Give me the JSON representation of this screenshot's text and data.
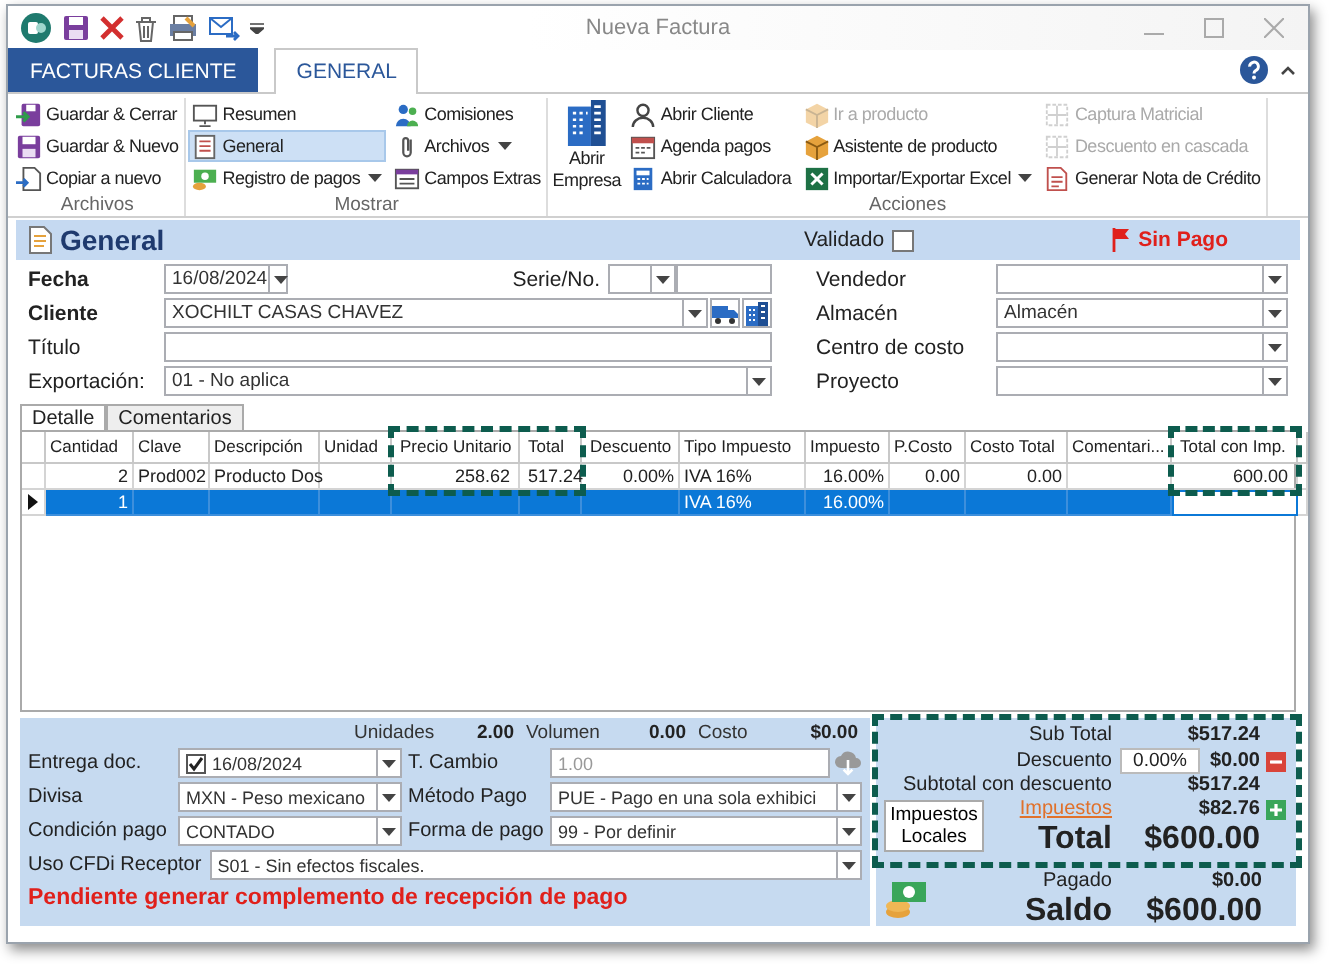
{
  "window": {
    "title": "Nueva Factura"
  },
  "ribbon": {
    "tabs": [
      {
        "label": "FACTURAS CLIENTE",
        "kind": "app",
        "selected": false
      },
      {
        "label": "GENERAL",
        "kind": "tab",
        "selected": true
      }
    ],
    "groups": [
      {
        "title": "Archivos",
        "columns": [
          [
            {
              "label": "Guardar & Cerrar",
              "kind": "small",
              "disabled": false,
              "selected": false,
              "dropdown": false
            },
            {
              "label": "Guardar & Nuevo",
              "kind": "small",
              "disabled": false,
              "selected": false,
              "dropdown": false
            },
            {
              "label": "Copiar a nuevo",
              "kind": "small",
              "disabled": false,
              "selected": false,
              "dropdown": false
            }
          ]
        ]
      },
      {
        "title": "Mostrar",
        "columns": [
          [
            {
              "label": "Resumen",
              "kind": "small",
              "disabled": false,
              "selected": false,
              "dropdown": false
            },
            {
              "label": "General",
              "kind": "small",
              "disabled": false,
              "selected": true,
              "dropdown": false
            },
            {
              "label": "Registro de pagos",
              "kind": "small",
              "disabled": false,
              "selected": false,
              "dropdown": true
            }
          ],
          [
            {
              "label": "Comisiones",
              "kind": "small",
              "disabled": false,
              "selected": false,
              "dropdown": false
            },
            {
              "label": "Archivos",
              "kind": "small",
              "disabled": false,
              "selected": false,
              "dropdown": true
            },
            {
              "label": "Campos Extras",
              "kind": "small",
              "disabled": false,
              "selected": false,
              "dropdown": false
            }
          ]
        ]
      },
      {
        "title": "Acciones",
        "columns": [
          [
            {
              "label": "Abrir Empresa",
              "kind": "large",
              "disabled": false,
              "selected": false,
              "dropdown": false
            }
          ],
          [
            {
              "label": "Abrir Cliente",
              "kind": "small",
              "disabled": false,
              "selected": false,
              "dropdown": false
            },
            {
              "label": "Agenda pagos",
              "kind": "small",
              "disabled": false,
              "selected": false,
              "dropdown": false
            },
            {
              "label": "Abrir Calculadora",
              "kind": "small",
              "disabled": false,
              "selected": false,
              "dropdown": false
            }
          ],
          [
            {
              "label": "Ir a producto",
              "kind": "small",
              "disabled": true,
              "selected": false,
              "dropdown": false
            },
            {
              "label": "Asistente de producto",
              "kind": "small",
              "disabled": false,
              "selected": false,
              "dropdown": false
            },
            {
              "label": "Importar/Exportar Excel",
              "kind": "small",
              "disabled": false,
              "selected": false,
              "dropdown": true
            }
          ],
          [
            {
              "label": "Captura Matricial",
              "kind": "small",
              "disabled": true,
              "selected": false,
              "dropdown": false
            },
            {
              "label": "Descuento en cascada",
              "kind": "small",
              "disabled": true,
              "selected": false,
              "dropdown": false
            },
            {
              "label": "Generar Nota de Crédito",
              "kind": "small",
              "disabled": false,
              "selected": false,
              "dropdown": false
            }
          ]
        ]
      }
    ]
  },
  "form": {
    "title": "General",
    "validated": {
      "label": "Validado",
      "checked": false
    },
    "status": "Sin Pago",
    "left": [
      {
        "label": "Fecha",
        "required": true,
        "kind": "date",
        "value": "16/08/2024"
      },
      {
        "label": "Cliente",
        "required": true,
        "kind": "combo-tools",
        "value": "XOCHILT CASAS CHAVEZ"
      },
      {
        "label": "Título",
        "required": false,
        "kind": "text"
      },
      {
        "label": "Exportación:",
        "required": false,
        "kind": "combo",
        "value": "01 - No aplica"
      }
    ],
    "serie": {
      "label": "Serie/No."
    },
    "right": [
      {
        "label": "Vendedor",
        "required": false,
        "kind": "combo"
      },
      {
        "label": "Almacén",
        "required": false,
        "kind": "combo",
        "value": "Almacén"
      },
      {
        "label": "Centro de costo",
        "required": false,
        "kind": "combo"
      },
      {
        "label": "Proyecto",
        "required": false,
        "kind": "combo"
      }
    ]
  },
  "detail_tabs": [
    {
      "label": "Detalle",
      "selected": true
    },
    {
      "label": "Comentarios",
      "selected": false
    }
  ],
  "grid": {
    "columns": [
      {
        "label": "Cantidad",
        "kind": "number",
        "highlighted": false
      },
      {
        "label": "Clave",
        "kind": "text",
        "highlighted": false
      },
      {
        "label": "Descripción",
        "kind": "text",
        "highlighted": false
      },
      {
        "label": "Unidad",
        "kind": "text",
        "highlighted": false
      },
      {
        "label": "Precio Unitario",
        "kind": "number",
        "highlighted": true
      },
      {
        "label": "Total",
        "kind": "number",
        "highlighted": true
      },
      {
        "label": "Descuento",
        "kind": "number",
        "highlighted": false
      },
      {
        "label": "Tipo Impuesto",
        "kind": "text",
        "highlighted": false
      },
      {
        "label": "Impuesto",
        "kind": "number",
        "highlighted": false
      },
      {
        "label": "P.Costo",
        "kind": "number",
        "highlighted": false
      },
      {
        "label": "Costo Total",
        "kind": "number",
        "highlighted": false
      },
      {
        "label": "Comentari...",
        "kind": "text",
        "highlighted": false
      },
      {
        "label": "Total con Imp.",
        "kind": "number",
        "highlighted": true
      }
    ],
    "rows": [
      {
        "current": false,
        "selected": false,
        "cells": [
          {
            "value": "2",
            "focused": false
          },
          {
            "value": "Prod002",
            "focused": false
          },
          {
            "value": "Producto Dos",
            "focused": false
          },
          {
            "focused": false
          },
          {
            "value": "258.62",
            "focused": false
          },
          {
            "value": "517.24",
            "focused": false
          },
          {
            "value": "0.00%",
            "focused": false
          },
          {
            "value": "IVA 16%",
            "focused": false
          },
          {
            "value": "16.00%",
            "focused": false
          },
          {
            "value": "0.00",
            "focused": false
          },
          {
            "value": "0.00",
            "focused": false
          },
          {
            "focused": false
          },
          {
            "value": "600.00",
            "focused": false
          }
        ]
      },
      {
        "current": true,
        "selected": true,
        "cells": [
          {
            "value": "1",
            "focused": false
          },
          {
            "focused": false
          },
          {
            "focused": false
          },
          {
            "focused": false
          },
          {
            "focused": false
          },
          {
            "focused": false
          },
          {
            "focused": false
          },
          {
            "value": "IVA 16%",
            "focused": false
          },
          {
            "value": "16.00%",
            "focused": false
          },
          {
            "focused": false
          },
          {
            "focused": false
          },
          {
            "focused": false
          },
          {
            "focused": true
          }
        ]
      }
    ]
  },
  "footer": {
    "summary": [
      {
        "label": "Unidades",
        "value": "2.00"
      },
      {
        "label": "Volumen",
        "value": "0.00"
      },
      {
        "label": "Costo",
        "value": "$0.00"
      }
    ],
    "fields": [
      {
        "label": "Entrega doc.",
        "kind": "check-date",
        "checked": true,
        "disabled": false,
        "value": "16/08/2024"
      },
      {
        "label": "T. Cambio",
        "kind": "text-button",
        "disabled": true,
        "value": "1.00"
      },
      {
        "label": "Divisa",
        "kind": "combo",
        "disabled": false,
        "value": "MXN - Peso mexicano"
      },
      {
        "label": "Método Pago",
        "kind": "combo",
        "disabled": false,
        "value": "PUE - Pago en una sola exhibici"
      },
      {
        "label": "Condición pago",
        "kind": "combo",
        "disabled": false,
        "value": "CONTADO"
      },
      {
        "label": "Forma de pago",
        "kind": "combo",
        "disabled": false,
        "value": "99 - Por definir"
      },
      {
        "label": "Uso CFDi Receptor",
        "kind": "wide-combo",
        "disabled": false,
        "value": "S01 - Sin efectos fiscales."
      }
    ],
    "warning": "Pendiente generar complemento de recepción de pago"
  },
  "totals": {
    "highlighted": true,
    "subtotal": {
      "label": "Sub Total",
      "value": "$517.24"
    },
    "discount": {
      "label": "Descuento",
      "rate": "0.00%",
      "value": "$0.00"
    },
    "subtotal_discount": {
      "label": "Subtotal con descuento",
      "value": "$517.24"
    },
    "local_taxes_button": "Impuestos Locales",
    "taxes": {
      "label": "Impuestos",
      "value": "$82.76"
    },
    "total": {
      "label": "Total",
      "value": "$600.00"
    },
    "paid": {
      "label": "Pagado",
      "value": "$0.00"
    },
    "balance": {
      "label": "Saldo",
      "value": "$600.00"
    }
  }
}
